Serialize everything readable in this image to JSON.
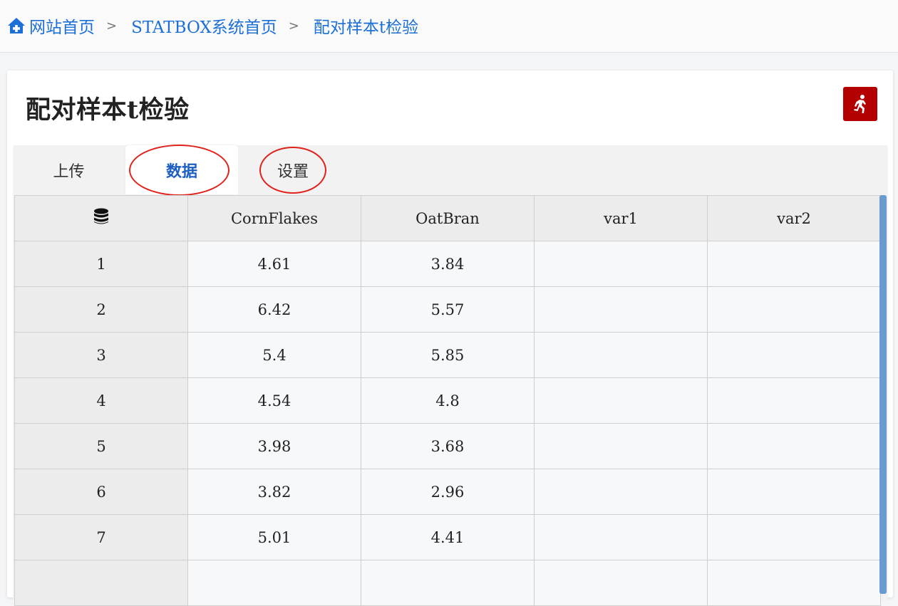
{
  "breadcrumb": {
    "items": [
      {
        "label": "网站首页"
      },
      {
        "label": "STATBOX系统首页"
      },
      {
        "label": "配对样本t检验"
      }
    ],
    "separator": ">"
  },
  "page": {
    "title": "配对样本t检验"
  },
  "tabs": [
    {
      "label": "上传",
      "active": false
    },
    {
      "label": "数据",
      "active": true
    },
    {
      "label": "设置",
      "active": false
    }
  ],
  "grid": {
    "index_header_icon": "database-icon",
    "columns": [
      "CornFlakes",
      "OatBran",
      "var1",
      "var2"
    ],
    "rows": [
      {
        "index": "1",
        "values": [
          "4.61",
          "3.84",
          "",
          ""
        ]
      },
      {
        "index": "2",
        "values": [
          "6.42",
          "5.57",
          "",
          ""
        ]
      },
      {
        "index": "3",
        "values": [
          "5.4",
          "5.85",
          "",
          ""
        ]
      },
      {
        "index": "4",
        "values": [
          "4.54",
          "4.8",
          "",
          ""
        ]
      },
      {
        "index": "5",
        "values": [
          "3.98",
          "3.68",
          "",
          ""
        ]
      },
      {
        "index": "6",
        "values": [
          "3.82",
          "2.96",
          "",
          ""
        ]
      },
      {
        "index": "7",
        "values": [
          "5.01",
          "4.41",
          "",
          ""
        ]
      },
      {
        "index": "",
        "values": [
          "",
          "",
          "",
          ""
        ]
      }
    ]
  },
  "colors": {
    "link": "#1c6fd6",
    "run_button": "#b30000",
    "annotation": "#e0221b",
    "scrollbar": "#6a9bd0"
  }
}
